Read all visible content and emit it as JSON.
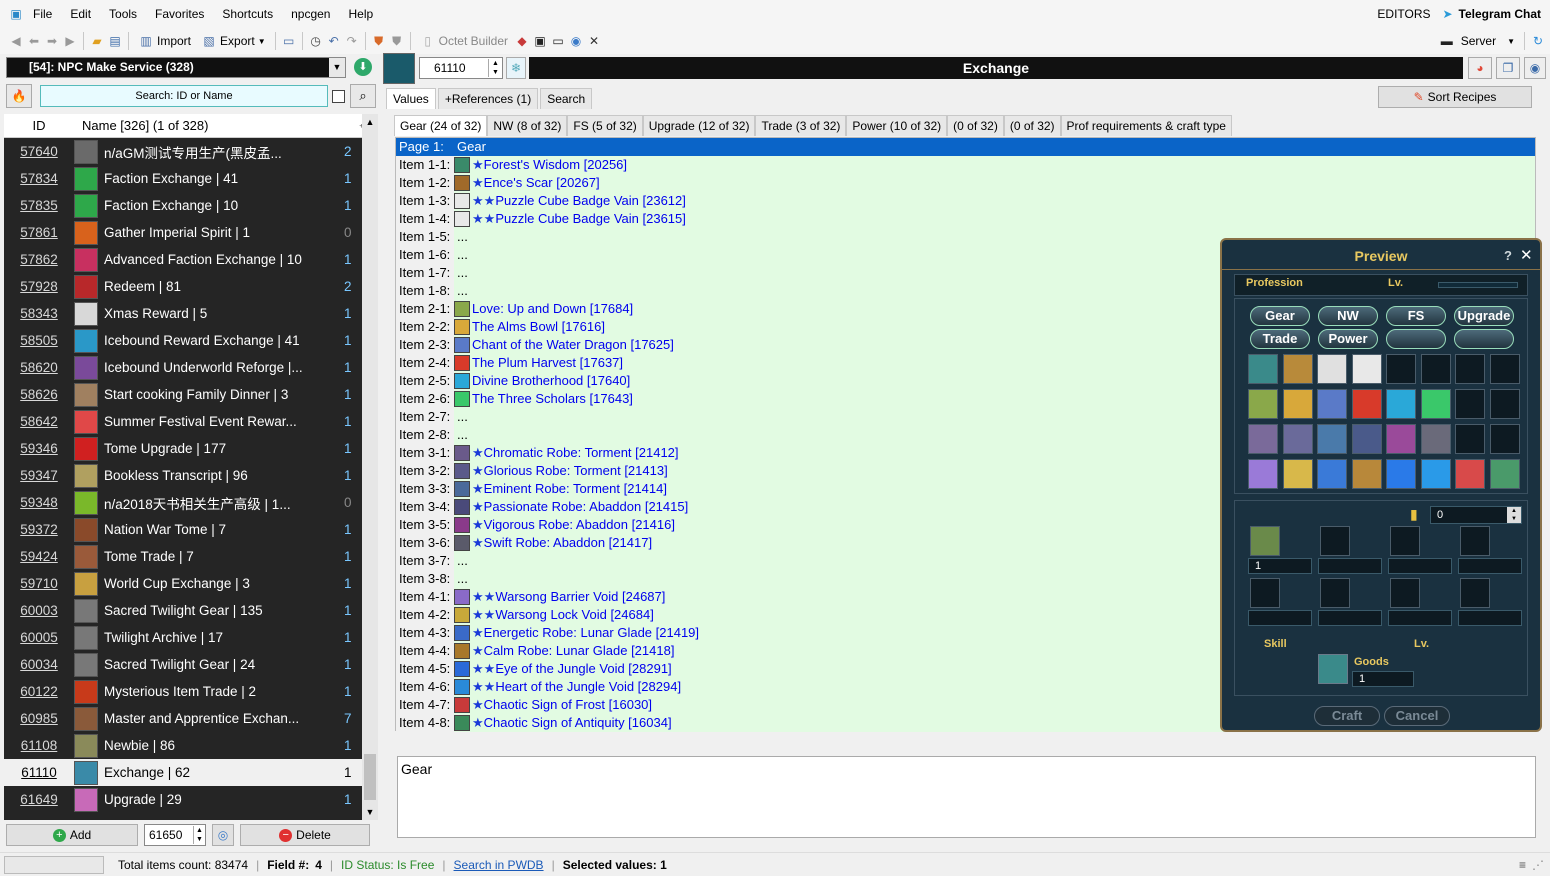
{
  "menu": [
    "File",
    "Edit",
    "Tools",
    "Favorites",
    "Shortcuts",
    "npcgen",
    "Help"
  ],
  "menu_right": {
    "editors": "EDITORS",
    "telegram": "Telegram Chat"
  },
  "toolbar": {
    "import": "Import",
    "export": "Export",
    "octet": "Octet Builder",
    "server": "Server"
  },
  "left": {
    "combo": "[54]: NPC Make Service (328)",
    "search_placeholder": "Search: ID or Name",
    "head_id": "ID",
    "head_name": "Name [326] (1 of 328)",
    "rows": [
      {
        "id": "57640",
        "name": "n/aGM测试专用生产(黑皮孟...",
        "count": "2",
        "color": "#6a6a6a"
      },
      {
        "id": "57834",
        "name": "Faction Exchange | 41",
        "count": "1",
        "color": "#2ea84a"
      },
      {
        "id": "57835",
        "name": "Faction Exchange | 10",
        "count": "1",
        "color": "#2ea84a"
      },
      {
        "id": "57861",
        "name": "Gather Imperial Spirit | 1",
        "count": "0",
        "color": "#d8621c"
      },
      {
        "id": "57862",
        "name": "Advanced Faction Exchange | 10",
        "count": "1",
        "color": "#c83060"
      },
      {
        "id": "57928",
        "name": "Redeem | 81",
        "count": "2",
        "color": "#b8282a"
      },
      {
        "id": "58343",
        "name": "Xmas Reward | 5",
        "count": "1",
        "color": "#d8d8d8"
      },
      {
        "id": "58505",
        "name": "Icebound Reward Exchange | 41",
        "count": "1",
        "color": "#2a98c8"
      },
      {
        "id": "58620",
        "name": "Icebound Underworld Reforge |...",
        "count": "1",
        "color": "#7a4a9a"
      },
      {
        "id": "58626",
        "name": "Start cooking Family Dinner | 3",
        "count": "1",
        "color": "#a08060"
      },
      {
        "id": "58642",
        "name": "Summer Festival Event Rewar...",
        "count": "1",
        "color": "#e04848"
      },
      {
        "id": "59346",
        "name": "Tome Upgrade | 177",
        "count": "1",
        "color": "#d02020"
      },
      {
        "id": "59347",
        "name": "Bookless Transcript | 96",
        "count": "1",
        "color": "#b0a060"
      },
      {
        "id": "59348",
        "name": "n/a2018天书相关生产高级 | 1...",
        "count": "0",
        "color": "#7ab82a"
      },
      {
        "id": "59372",
        "name": "Nation War Tome | 7",
        "count": "1",
        "color": "#8a4a2a"
      },
      {
        "id": "59424",
        "name": "Tome Trade | 7",
        "count": "1",
        "color": "#9a5a3a"
      },
      {
        "id": "59710",
        "name": "World Cup Exchange | 3",
        "count": "1",
        "color": "#c8a040"
      },
      {
        "id": "60003",
        "name": "Sacred Twilight Gear | 135",
        "count": "1",
        "color": "#787878"
      },
      {
        "id": "60005",
        "name": "Twilight Archive | 17",
        "count": "1",
        "color": "#787878"
      },
      {
        "id": "60034",
        "name": "Sacred Twilight Gear | 24",
        "count": "1",
        "color": "#787878"
      },
      {
        "id": "60122",
        "name": "Mysterious Item Trade | 2",
        "count": "1",
        "color": "#c83a1a"
      },
      {
        "id": "60985",
        "name": "Master and Apprentice Exchan...",
        "count": "7",
        "color": "#8a5a3a"
      },
      {
        "id": "61108",
        "name": "Newbie | 86",
        "count": "1",
        "color": "#8a8a5a"
      },
      {
        "id": "61110",
        "name": "Exchange | 62",
        "count": "1",
        "color": "#3a8aa8",
        "selected": true
      },
      {
        "id": "61649",
        "name": "Upgrade | 29",
        "count": "1",
        "color": "#c86ab8"
      }
    ],
    "add": "Add",
    "spin_value": "61650",
    "delete": "Delete"
  },
  "right": {
    "id_value": "61110",
    "title": "Exchange",
    "sort_recipes": "Sort Recipes",
    "tabs": [
      "Values",
      "+References (1)",
      "Search"
    ],
    "subtabs": [
      "Gear (24 of 32)",
      "NW (8 of 32)",
      "FS (5 of 32)",
      "Upgrade (12 of 32)",
      "Trade (3 of 32)",
      "Power (10 of 32)",
      "(0 of 32)",
      "(0 of 32)",
      "Prof requirements & craft type"
    ],
    "page_label": "Page 1:",
    "page_value": "Gear",
    "items": [
      {
        "label": "Item 1-1:",
        "stars": "★",
        "text": "Forest's Wisdom [20256]",
        "color": "#3a8a6a"
      },
      {
        "label": "Item 1-2:",
        "stars": "★",
        "text": "Ence's Scar [20267]",
        "color": "#a06a2a"
      },
      {
        "label": "Item 1-3:",
        "stars": "★★",
        "text": "Puzzle Cube Badge Vain [23612]",
        "color": "#e8e8e8"
      },
      {
        "label": "Item 1-4:",
        "stars": "★★",
        "text": "Puzzle Cube Badge Vain [23615]",
        "color": "#e8e8e8"
      },
      {
        "label": "Item 1-5:",
        "stars": "",
        "text": "...",
        "color": ""
      },
      {
        "label": "Item 1-6:",
        "stars": "",
        "text": "...",
        "color": ""
      },
      {
        "label": "Item 1-7:",
        "stars": "",
        "text": "...",
        "color": ""
      },
      {
        "label": "Item 1-8:",
        "stars": "",
        "text": "...",
        "color": ""
      },
      {
        "label": "Item 2-1:",
        "stars": "",
        "text": "Love: Up and Down [17684]",
        "color": "#8aa84a"
      },
      {
        "label": "Item 2-2:",
        "stars": "",
        "text": "The Alms Bowl [17616]",
        "color": "#d8a83a"
      },
      {
        "label": "Item 2-3:",
        "stars": "",
        "text": "Chant of the Water Dragon [17625]",
        "color": "#5a7ac8"
      },
      {
        "label": "Item 2-4:",
        "stars": "",
        "text": "The Plum Harvest [17637]",
        "color": "#d83a2a"
      },
      {
        "label": "Item 2-5:",
        "stars": "",
        "text": "Divine Brotherhood [17640]",
        "color": "#2aa8d8"
      },
      {
        "label": "Item 2-6:",
        "stars": "",
        "text": "The Three Scholars [17643]",
        "color": "#3ac86a"
      },
      {
        "label": "Item 2-7:",
        "stars": "",
        "text": "...",
        "color": ""
      },
      {
        "label": "Item 2-8:",
        "stars": "",
        "text": "...",
        "color": ""
      },
      {
        "label": "Item 3-1:",
        "stars": "★",
        "text": "Chromatic Robe: Torment [21412]",
        "color": "#6a5a8a"
      },
      {
        "label": "Item 3-2:",
        "stars": "★",
        "text": "Glorious Robe: Torment [21413]",
        "color": "#5a5a8a"
      },
      {
        "label": "Item 3-3:",
        "stars": "★",
        "text": "Eminent Robe: Torment [21414]",
        "color": "#4a6a9a"
      },
      {
        "label": "Item 3-4:",
        "stars": "★",
        "text": "Passionate Robe: Abaddon [21415]",
        "color": "#4a4a7a"
      },
      {
        "label": "Item 3-5:",
        "stars": "★",
        "text": "Vigorous Robe: Abaddon [21416]",
        "color": "#8a3a8a"
      },
      {
        "label": "Item 3-6:",
        "stars": "★",
        "text": "Swift Robe: Abaddon [21417]",
        "color": "#5a5a6a"
      },
      {
        "label": "Item 3-7:",
        "stars": "",
        "text": "...",
        "color": ""
      },
      {
        "label": "Item 3-8:",
        "stars": "",
        "text": "...",
        "color": ""
      },
      {
        "label": "Item 4-1:",
        "stars": "★★",
        "text": "Warsong Barrier Void [24687]",
        "color": "#8a6ac8"
      },
      {
        "label": "Item 4-2:",
        "stars": "★★",
        "text": "Warsong Lock Void [24684]",
        "color": "#c8a83a"
      },
      {
        "label": "Item 4-3:",
        "stars": "★",
        "text": "Energetic Robe: Lunar Glade [21419]",
        "color": "#3a6ac8"
      },
      {
        "label": "Item 4-4:",
        "stars": "★",
        "text": "Calm Robe: Lunar Glade [21418]",
        "color": "#a8782a"
      },
      {
        "label": "Item 4-5:",
        "stars": "★★",
        "text": "Eye of the Jungle Void [28291]",
        "color": "#2a6ad8"
      },
      {
        "label": "Item 4-6:",
        "stars": "★★",
        "text": "Heart of the Jungle Void [28294]",
        "color": "#2a8ad8"
      },
      {
        "label": "Item 4-7:",
        "stars": "★",
        "text": "Chaotic Sign of Frost [16030]",
        "color": "#c83a3a"
      },
      {
        "label": "Item 4-8:",
        "stars": "★",
        "text": "Chaotic Sign of Antiquity [16034]",
        "color": "#3a8a5a"
      }
    ],
    "textarea": "Gear"
  },
  "preview": {
    "title": "Preview",
    "profession": "Profession",
    "lv": "Lv.",
    "tabs": [
      "Gear",
      "NW",
      "FS",
      "Upgrade",
      "Trade",
      "Power",
      "",
      ""
    ],
    "money": "0",
    "qty": "1",
    "skill": "Skill",
    "lv2": "Lv.",
    "goods": "Goods",
    "goods_qty": "1",
    "craft": "Craft",
    "cancel": "Cancel",
    "slot_colors": [
      "#3a8a8a",
      "#b88a3a",
      "#e0e0e0",
      "#e8e8e8",
      "",
      "",
      "",
      "",
      "#8aa84a",
      "#d8a83a",
      "#5a7ac8",
      "#d83a2a",
      "#2aa8d8",
      "#3ac86a",
      "",
      "",
      "#7a6a9a",
      "#6a6a9a",
      "#4a7aaa",
      "#4a5a8a",
      "#9a4a9a",
      "#6a6a7a",
      "",
      "",
      "#9a7ad8",
      "#d8b84a",
      "#3a7ad8",
      "#b8883a",
      "#2a7ae8",
      "#2a9ae8",
      "#d84a4a",
      "#4a9a6a"
    ]
  },
  "status": {
    "total": "Total items count: 83474",
    "field_label": "Field #:",
    "field_value": "4",
    "id_status": "ID Status: Is Free",
    "search_pwdb": "Search in PWDB",
    "selected": "Selected values: 1"
  }
}
